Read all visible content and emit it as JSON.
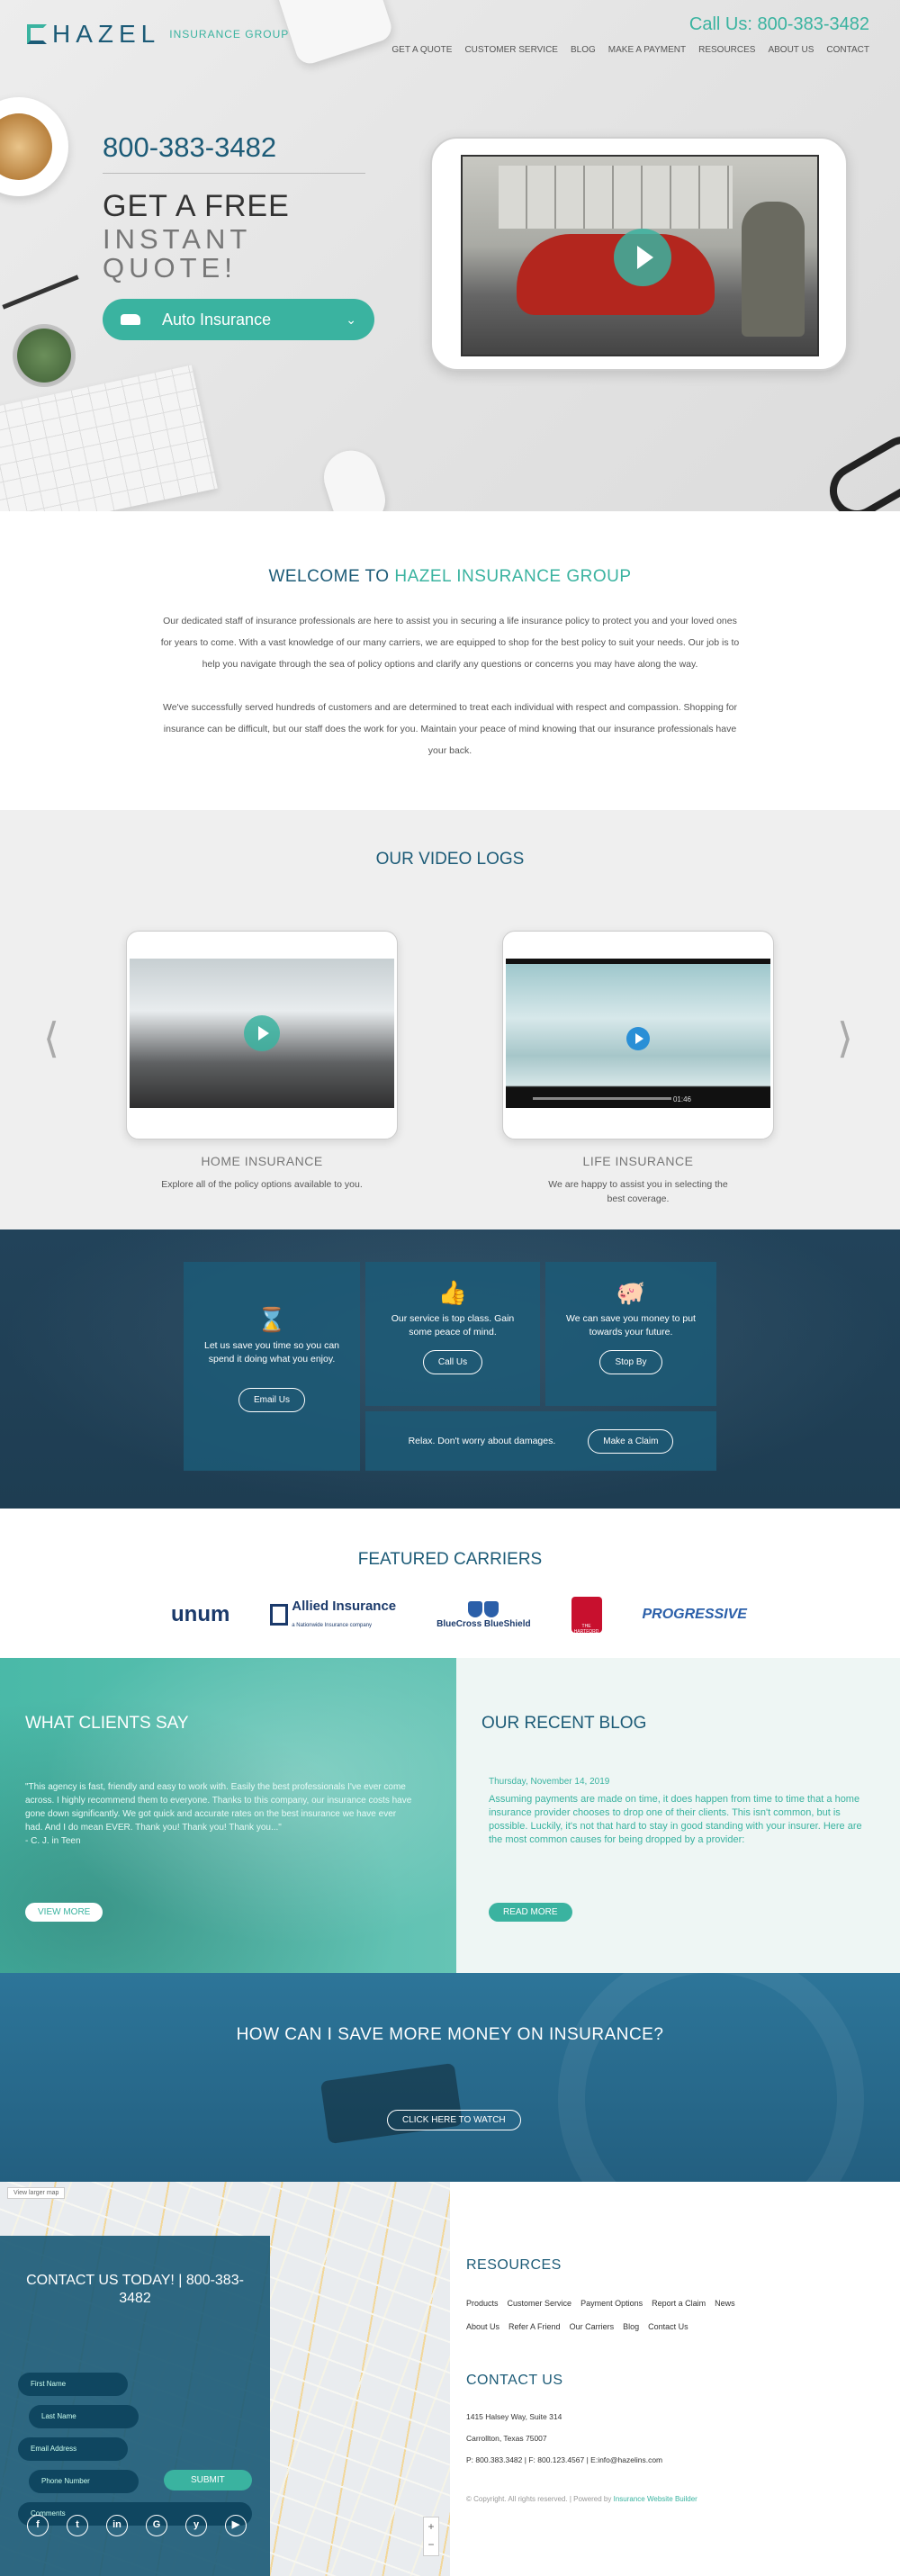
{
  "header": {
    "logo_name": "HAZEL",
    "logo_sub": "INSURANCE GROUP",
    "phone": "Call Us: 800-383-3482",
    "nav": [
      "GET A QUOTE",
      "CUSTOMER SERVICE",
      "BLOG",
      "MAKE A PAYMENT",
      "RESOURCES",
      "ABOUT US",
      "CONTACT"
    ]
  },
  "hero": {
    "phone": "800-383-3482",
    "title_line1": "GET A FREE",
    "title_line2": "INSTANT QUOTE!",
    "select_value": "Auto Insurance"
  },
  "welcome": {
    "title_prefix": "WELCOME TO",
    "title_accent": "HAZEL INSURANCE GROUP",
    "p1": "Our dedicated staff of insurance professionals are here to assist you in securing a life insurance policy to protect you and your loved ones for years to come. With a vast knowledge of our many carriers, we are equipped to shop for the best policy to suit your needs. Our job is to help you navigate through the sea of policy options and clarify any questions or concerns you may have along the way.",
    "p2": "We've successfully served hundreds of customers and are determined to treat each individual with respect and compassion. Shopping for insurance can be difficult, but our staff does the work for you. Maintain your peace of mind knowing that our insurance professionals have your back."
  },
  "videos": {
    "title": "OUR VIDEO LOGS",
    "items": [
      {
        "title": "HOME INSURANCE",
        "desc": "Explore all of the policy options available to you."
      },
      {
        "title": "LIFE INSURANCE",
        "desc": "We are happy to assist you in selecting the best coverage.",
        "time": "01:46"
      }
    ]
  },
  "services": {
    "time_text": "Let us save you time so you can spend it doing what you enjoy.",
    "time_btn": "Email Us",
    "service_text": "Our service is top class. Gain some peace of mind.",
    "service_btn": "Call Us",
    "money_text": "We can save you money to put towards your future.",
    "money_btn": "Stop By",
    "damage_text": "Relax. Don't worry about damages.",
    "damage_btn": "Make a Claim"
  },
  "carriers": {
    "title": "FEATURED CARRIERS",
    "logos": [
      "unum",
      "Allied Insurance",
      "BlueCross BlueShield",
      "THE HARTFORD",
      "PROGRESSIVE"
    ],
    "allied_sub": "a Nationwide Insurance company"
  },
  "clients": {
    "title": "WHAT CLIENTS SAY",
    "quote": "\"This agency is fast, friendly and easy to work with. Easily the best professionals I've ever come across. I highly recommend them to everyone. Thanks to this company, our insurance costs have gone down significantly. We got quick and accurate rates on the best insurance we have ever had. And I do mean EVER. Thank you! Thank you! Thank you...\"",
    "author": "- C. J. in Teen",
    "btn": "VIEW MORE"
  },
  "blog": {
    "title": "OUR RECENT BLOG",
    "date": "Thursday, November 14, 2019",
    "text": "Assuming payments are made on time, it does happen from time to time that a home insurance provider chooses to drop one of their clients. This isn't common, but is possible. Luckily, it's not that hard to stay in good standing with your insurer. Here are the most common causes for being dropped by a provider:",
    "btn": "READ MORE"
  },
  "save": {
    "title": "HOW CAN I SAVE MORE MONEY ON INSURANCE?",
    "btn": "CLICK HERE TO WATCH"
  },
  "contact": {
    "map_link": "View larger map",
    "title": "CONTACT US TODAY! | 800-383-3482",
    "first": "First Name",
    "last": "Last Name",
    "email": "Email Address",
    "phone": "Phone Number",
    "comments": "Comments",
    "submit": "SUBMIT",
    "socials": [
      "f",
      "t",
      "in",
      "G",
      "y",
      "▶"
    ]
  },
  "resources": {
    "title": "RESOURCES",
    "row1": [
      "Products",
      "Customer Service",
      "Payment Options",
      "Report a Claim",
      "News"
    ],
    "row2": [
      "About Us",
      "Refer A Friend",
      "Our Carriers",
      "Blog",
      "Contact Us"
    ]
  },
  "contact_info": {
    "title": "CONTACT US",
    "street": "1415 Halsey Way, Suite 314",
    "city": "Carrollton, Texas 75007",
    "phones": "P: 800.383.3482 | F: 800.123.4567 | E:info@hazelins.com",
    "copyright": "© Copyright. All rights reserved. | Powered by",
    "powered": "Insurance Website Builder"
  }
}
